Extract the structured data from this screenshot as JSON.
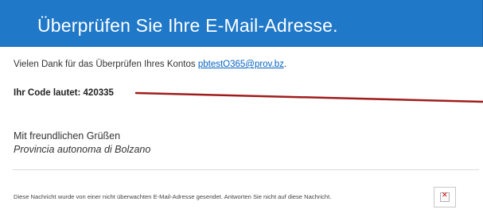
{
  "header": {
    "title": "Überprüfen Sie Ihre E-Mail-Adresse.",
    "background_color": "#1f78c8"
  },
  "message": {
    "intro_text": "Vielen Dank für das Überprüfen Ihres Kontos ",
    "account_email": "pbtestO365@prov.bz",
    "intro_suffix": ".",
    "code_line": "Ihr Code lautet: 420335",
    "greeting": "Mit freundlichen Grüßen",
    "signature": "Provincia autonoma di Bolzano"
  },
  "footer": {
    "note": "Diese Nachricht wurde von einer nicht überwachten E-Mail-Adresse gesendet. Antworten Sie nicht auf diese Nachricht."
  },
  "icons": {
    "broken_image": "broken-image-icon"
  },
  "colors": {
    "link": "#0563c1",
    "annotation_line": "#a01c1c"
  }
}
